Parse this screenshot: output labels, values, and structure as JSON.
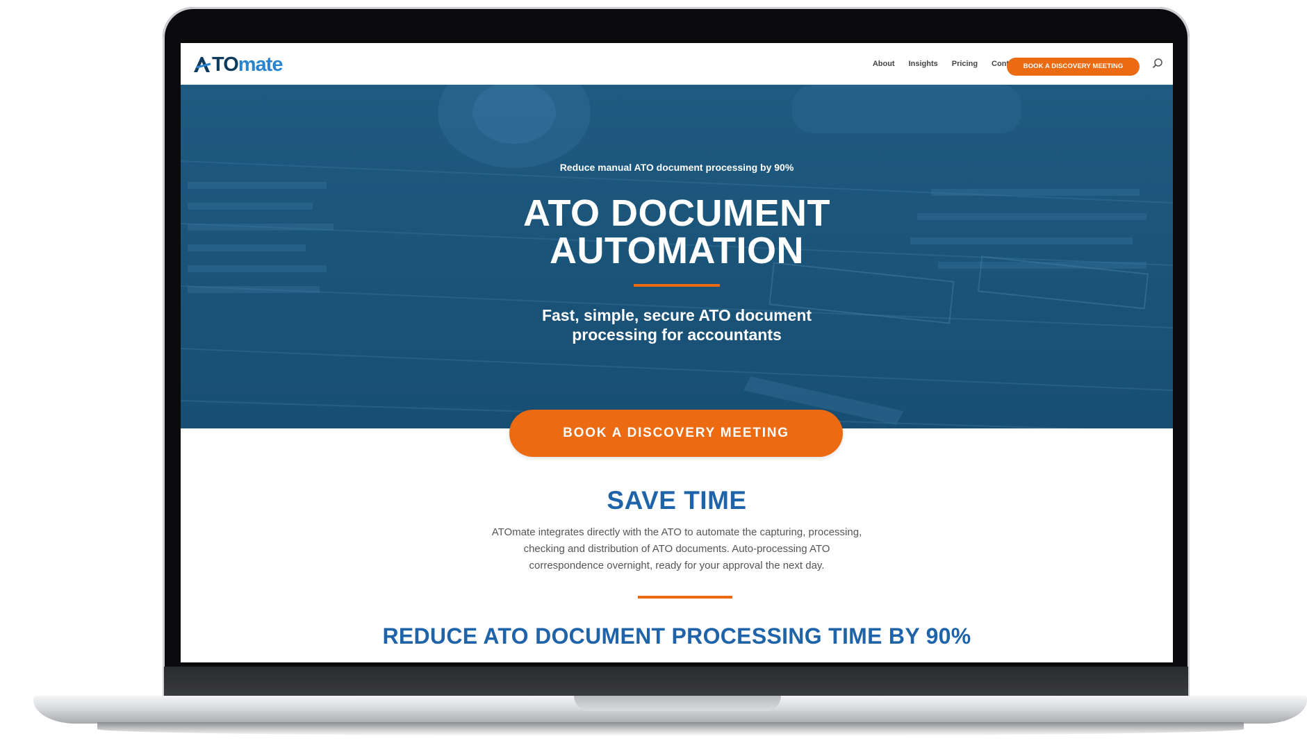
{
  "brand": {
    "logo_mark": "A",
    "logo_to": "TO",
    "logo_mate": "mate"
  },
  "nav": {
    "items": [
      "About",
      "Insights",
      "Pricing",
      "Contact"
    ],
    "cta_label": "BOOK A DISCOVERY MEETING",
    "search_icon": "search-icon"
  },
  "hero": {
    "kicker": "Reduce manual ATO document processing by 90%",
    "title_line1": "ATO DOCUMENT",
    "title_line2": "AUTOMATION",
    "subtitle_line1": "Fast, simple, secure ATO document",
    "subtitle_line2": "processing for accountants",
    "cta_label": "BOOK A DISCOVERY MEETING"
  },
  "save_time": {
    "title": "SAVE TIME",
    "body_line1": "ATOmate integrates directly with the ATO to automate the capturing, processing,",
    "body_line2": "checking and distribution of ATO documents. Auto-processing ATO",
    "body_line3": "correspondence overnight, ready for your approval the next day."
  },
  "reduce": {
    "title": "REDUCE ATO DOCUMENT PROCESSING TIME BY 90%"
  },
  "colors": {
    "accent_orange": "#ec6a11",
    "hero_blue": "#1d5a80",
    "heading_blue": "#1f63a8",
    "logo_navy": "#0e3b5c",
    "logo_blue": "#2a83cf"
  }
}
